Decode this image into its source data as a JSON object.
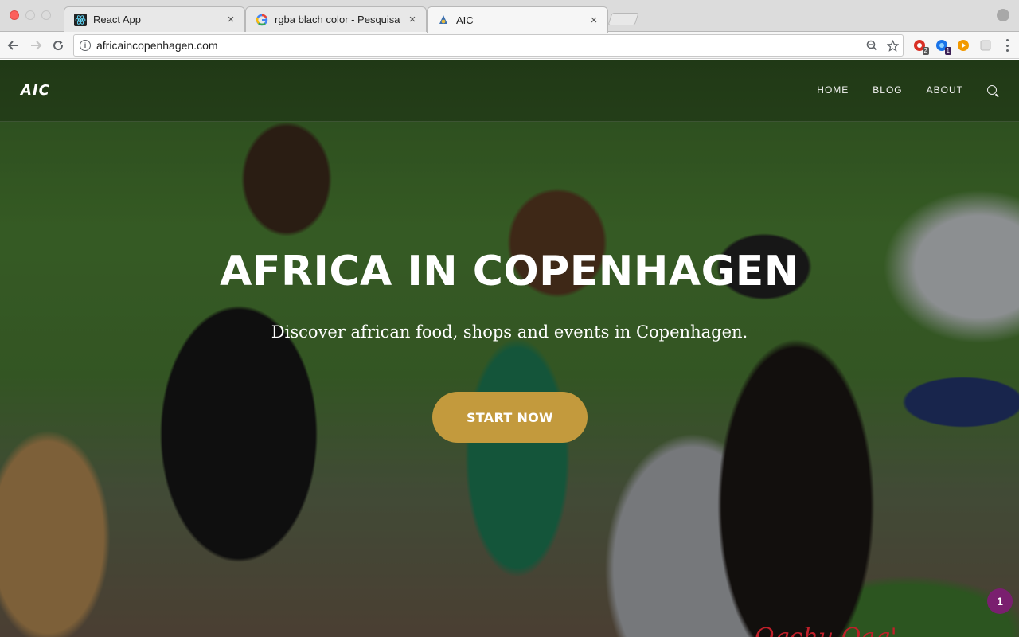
{
  "browser": {
    "tabs": [
      {
        "title": "React App",
        "icon": "react-icon"
      },
      {
        "title": "rgba blach color - Pesquisa Go",
        "icon": "google-icon"
      },
      {
        "title": "AIC",
        "icon": "aic-favicon"
      }
    ],
    "active_tab_index": 2,
    "close_glyph": "×",
    "url": "africaincopenhagen.com",
    "extensions": [
      {
        "name": "red-extension-icon",
        "badge": "2",
        "color": "#d93025"
      },
      {
        "name": "blue-extension-icon",
        "badge": "1",
        "color": "#1a73e8"
      },
      {
        "name": "orange-play-extension-icon",
        "badge": "",
        "color": "#f29900"
      },
      {
        "name": "gray-extension-icon",
        "badge": "",
        "color": "#bdbdbd"
      }
    ]
  },
  "site": {
    "logo": "AIC",
    "nav": [
      "HOME",
      "BLOG",
      "ABOUT"
    ],
    "hero_title": "AFRICA IN COPENHAGEN",
    "hero_subtitle": "Discover african food, shops and events in Copenhagen.",
    "cta_label": "START NOW",
    "chat_badge": "1",
    "partial_script_text": "Oqchu Oaq'",
    "colors": {
      "cta": "#c39a3d",
      "chat": "#7a1f6f"
    }
  }
}
